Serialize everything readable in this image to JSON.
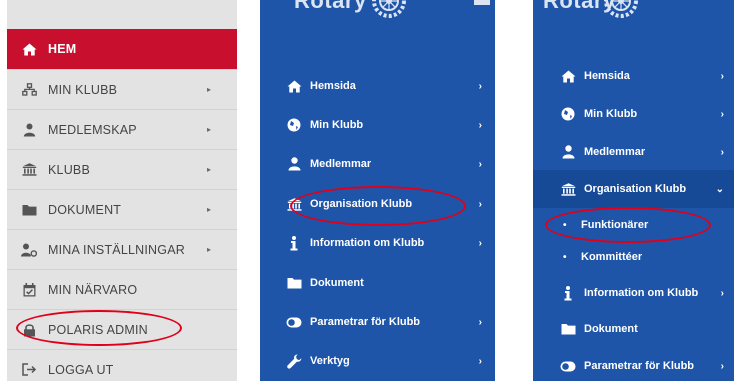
{
  "panel1": {
    "items": [
      {
        "label": "HEM",
        "icon": "home-icon",
        "has_chevron": false,
        "active": true
      },
      {
        "label": "MIN KLUBB",
        "icon": "sitemap-icon",
        "has_chevron": true
      },
      {
        "label": "MEDLEMSKAP",
        "icon": "user-icon",
        "has_chevron": true
      },
      {
        "label": "KLUBB",
        "icon": "bank-icon",
        "has_chevron": true
      },
      {
        "label": "DOKUMENT",
        "icon": "folder-icon",
        "has_chevron": true
      },
      {
        "label": "MINA INSTÄLLNINGAR",
        "icon": "user-settings-icon",
        "has_chevron": true
      },
      {
        "label": "MIN NÄRVARO",
        "icon": "calendar-icon",
        "has_chevron": false
      },
      {
        "label": "POLARIS ADMIN",
        "icon": "lock-icon",
        "has_chevron": false
      },
      {
        "label": "LOGGA UT",
        "icon": "logout-icon",
        "has_chevron": false
      }
    ],
    "chevron": "▸",
    "colors": {
      "background": "#e3e3e3",
      "active": "#c8102e",
      "text": "#444444"
    }
  },
  "panel2": {
    "brand_text": "Rotary",
    "items": [
      {
        "label": "Hemsida",
        "icon": "home-icon"
      },
      {
        "label": "Min Klubb",
        "icon": "globe-icon"
      },
      {
        "label": "Medlemmar",
        "icon": "user-icon"
      },
      {
        "label": "Organisation Klubb",
        "icon": "bank-icon"
      },
      {
        "label": "Information om Klubb",
        "icon": "info-icon"
      },
      {
        "label": "Dokument",
        "icon": "folder-icon",
        "no_chevron": true
      },
      {
        "label": "Parametrar för Klubb",
        "icon": "toggle-icon"
      },
      {
        "label": "Verktyg",
        "icon": "wrench-icon"
      }
    ],
    "chevron": "›",
    "colors": {
      "background": "#1e55a8"
    }
  },
  "panel3": {
    "brand_text": "Rotary",
    "items": [
      {
        "label": "Hemsida",
        "icon": "home-icon"
      },
      {
        "label": "Min Klubb",
        "icon": "globe-icon"
      },
      {
        "label": "Medlemmar",
        "icon": "user-icon"
      },
      {
        "label": "Organisation Klubb",
        "icon": "bank-icon",
        "expanded": true
      },
      {
        "label": "Funktionärer",
        "sub": true
      },
      {
        "label": "Kommittéer",
        "sub": true
      },
      {
        "label": "Information om Klubb",
        "icon": "info-icon"
      },
      {
        "label": "Dokument",
        "icon": "folder-icon",
        "no_chevron": true
      },
      {
        "label": "Parametrar för Klubb",
        "icon": "toggle-icon"
      }
    ],
    "chevron": "›",
    "chevron_open": "⌄",
    "bullet": "•",
    "colors": {
      "background": "#1e55a8",
      "active": "#174a96"
    }
  },
  "annotation_color": "#e0001b"
}
